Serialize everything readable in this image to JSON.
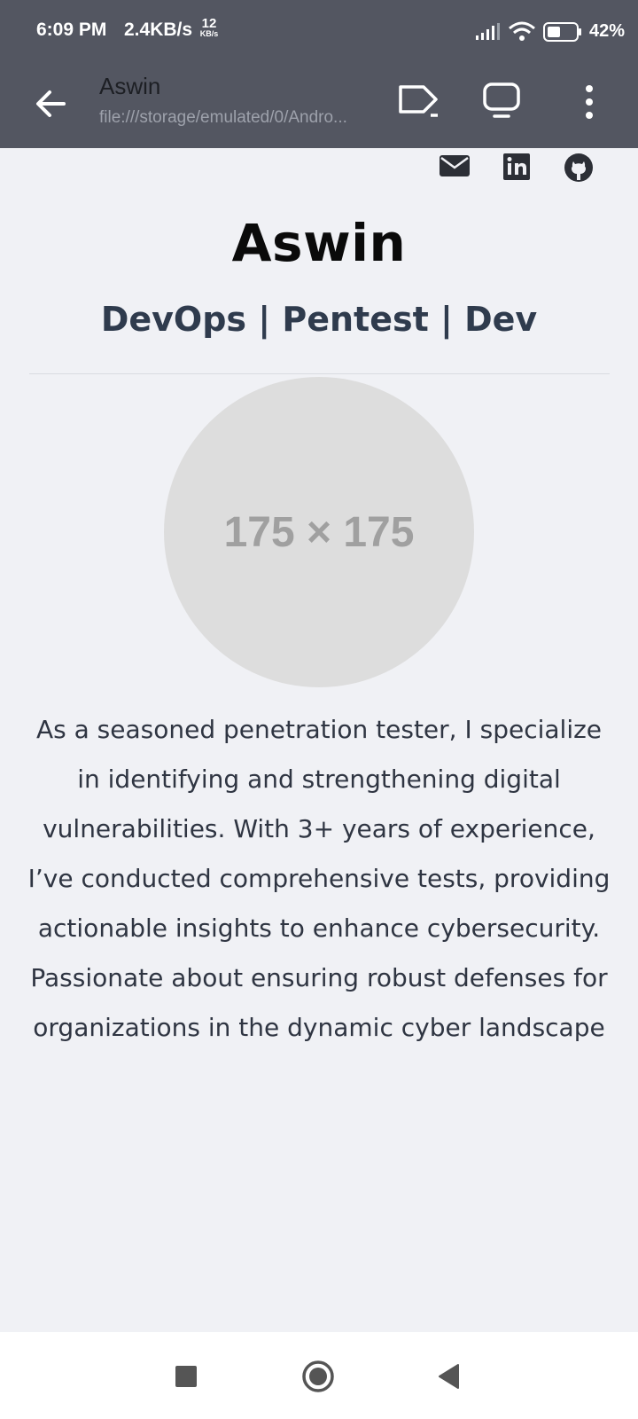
{
  "status_bar": {
    "time": "6:09 PM",
    "speed": "2.4KB/s",
    "speed_top": "12",
    "speed_bottom": "KB/s",
    "battery": "42%",
    "icons": [
      "signal-icon",
      "wifi-icon",
      "battery-icon"
    ]
  },
  "browser_bar": {
    "title": "Aswin",
    "url": "file:///storage/emulated/0/Andro...",
    "icons": [
      "back-arrow-icon",
      "cast-icon",
      "desktop-icon",
      "more-vert-icon"
    ]
  },
  "social_links": [
    "email-icon",
    "linkedin-icon",
    "github-icon"
  ],
  "profile": {
    "name": "Aswin",
    "role": "DevOps | Pentest | Dev",
    "avatar_placeholder": "175 × 175",
    "bio": "As a seasoned penetration tester, I specialize in identifying and strengthening digital vulnerabilities. With 3+ years of experience, I’ve conducted comprehensive tests, providing actionable insights to enhance cybersecurity. Passionate about ensuring robust defenses for organizations in the dynamic cyber landscape"
  },
  "nav_bar": {
    "icons": [
      "recent-apps-icon",
      "home-icon",
      "back-icon"
    ]
  },
  "colors": {
    "header_bg": "#535661",
    "page_bg": "#f0f1f5",
    "role_text": "#2f3b4d",
    "avatar_bg": "#dddddd"
  }
}
